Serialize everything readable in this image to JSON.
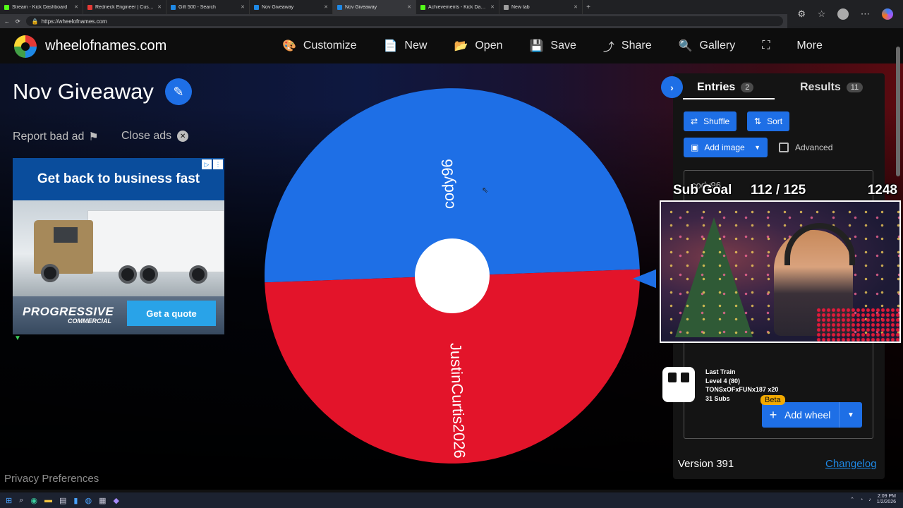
{
  "browser": {
    "tabs": [
      {
        "title": "Stream - Kick Dashboard",
        "color": "#53fc18",
        "active": false
      },
      {
        "title": "Redneck Engineer | Custom Build P",
        "color": "#e53935",
        "active": false
      },
      {
        "title": "Gift 500 - Search",
        "color": "#1e88e5",
        "active": false
      },
      {
        "title": "Nov Giveaway",
        "color": "#1e88e5",
        "active": false
      },
      {
        "title": "Nov Giveaway",
        "color": "#1e88e5",
        "active": true
      },
      {
        "title": "Achievements - Kick Dashboard",
        "color": "#53fc18",
        "active": false
      },
      {
        "title": "New tab",
        "color": "#9e9e9e",
        "active": false
      }
    ],
    "url": "https://wheelofnames.com",
    "close_glyph": "✕",
    "new_tab_glyph": "+"
  },
  "site": {
    "name": "wheelofnames.com",
    "nav": [
      {
        "label": "Customize",
        "icon": "palette-icon",
        "glyph": "🎨"
      },
      {
        "label": "New",
        "icon": "file-icon",
        "glyph": "📄"
      },
      {
        "label": "Open",
        "icon": "folder-icon",
        "glyph": "📂"
      },
      {
        "label": "Save",
        "icon": "save-icon",
        "glyph": "💾"
      },
      {
        "label": "Share",
        "icon": "share-icon",
        "glyph": "⤴"
      },
      {
        "label": "Gallery",
        "icon": "search-icon",
        "glyph": "🔍"
      },
      {
        "label": "",
        "icon": "fullscreen-icon",
        "glyph": "⛶"
      },
      {
        "label": "More",
        "icon": "more-icon",
        "glyph": ""
      }
    ]
  },
  "page": {
    "title": "Nov Giveaway",
    "report_ad": "Report bad ad",
    "close_ads": "Close ads",
    "privacy": "Privacy Preferences"
  },
  "ad": {
    "headline": "Get back to business fast",
    "brand": "PROGRESSIVE",
    "brand_sub": "COMMERCIAL",
    "cta": "Get a quote"
  },
  "wheel": {
    "entries": [
      {
        "name": "cody96",
        "color": "#1e6fe6"
      },
      {
        "name": "JustinCurtis2026",
        "color": "#e3142a"
      }
    ]
  },
  "panel": {
    "tabs": {
      "entries_label": "Entries",
      "entries_count": "2",
      "results_label": "Results",
      "results_count": "11"
    },
    "shuffle": "Shuffle",
    "sort": "Sort",
    "add_image": "Add image",
    "advanced": "Advanced",
    "entries_text": "cody96",
    "add_wheel": "Add wheel",
    "beta": "Beta",
    "version": "Version 391",
    "changelog": "Changelog"
  },
  "overlay": {
    "sub_goal_label": "Sub Goal",
    "sub_goal_value": "112 / 125",
    "sub_goal_number": "1248",
    "alert_lines": [
      "Last Train",
      "Level 4 (80)",
      "TONSxOFxFUNx187 x20",
      "31 Subs"
    ]
  },
  "taskbar": {
    "time": "2:09 PM",
    "date": "1/2/2026"
  }
}
